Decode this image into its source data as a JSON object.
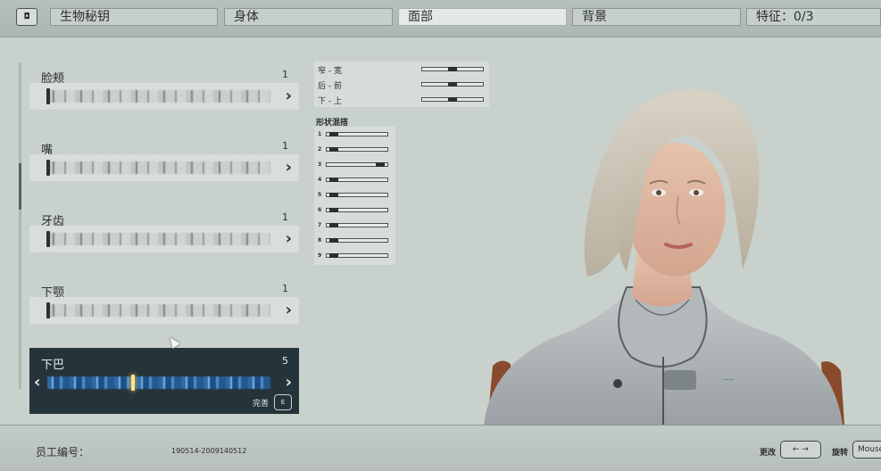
{
  "topbar": {
    "back_key": "◘",
    "tabs": [
      {
        "label": "生物秘钥"
      },
      {
        "label": "身体"
      },
      {
        "label": "面部"
      },
      {
        "label": "背景"
      },
      {
        "label": "特征：0/3"
      }
    ]
  },
  "features": [
    {
      "label": "脸颊",
      "value": "1"
    },
    {
      "label": "嘴",
      "value": "1"
    },
    {
      "label": "牙齿",
      "value": "1"
    },
    {
      "label": "下颚",
      "value": "1"
    },
    {
      "label": "下巴",
      "value": "5"
    }
  ],
  "active_feature": {
    "done_label": "完善",
    "done_key": "E"
  },
  "axes": [
    {
      "label": "窄 - 宽",
      "level": 0.5
    },
    {
      "label": "后 - 前",
      "level": 0.5
    },
    {
      "label": "下 - 上",
      "level": 0.5
    }
  ],
  "shape_blend": {
    "title": "形状混搭",
    "rows": [
      {
        "label": "1",
        "level": 0.05
      },
      {
        "label": "2",
        "level": 0.05
      },
      {
        "label": "3",
        "level": 0.95
      },
      {
        "label": "4",
        "level": 0.05
      },
      {
        "label": "5",
        "level": 0.05
      },
      {
        "label": "6",
        "level": 0.05
      },
      {
        "label": "7",
        "level": 0.05
      },
      {
        "label": "8",
        "level": 0.05
      },
      {
        "label": "9",
        "level": 0.05
      }
    ]
  },
  "bottombar": {
    "employee_label": "员工编号：",
    "employee_id": "190514-2009140512",
    "change_label": "更改",
    "change_key": "← →",
    "rotate_label": "旋转",
    "rotate_key": "Mouse"
  },
  "colors": {
    "active_panel": "#25343a",
    "active_tab": "#e4e9e6",
    "bar_blue": "#2d6aa6",
    "marker_gold": "#ffe48a"
  }
}
